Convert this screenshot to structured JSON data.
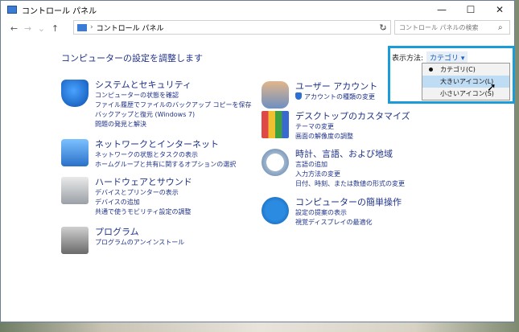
{
  "window": {
    "title": "コントロール パネル"
  },
  "address": {
    "crumb": "コントロール パネル"
  },
  "search": {
    "placeholder": "コントロール パネルの検索"
  },
  "heading": "コンピューターの設定を調整します",
  "viewby": {
    "label": "表示方法:",
    "value": "カテゴリ"
  },
  "dropdown": {
    "items": [
      "カテゴリ(C)",
      "大きいアイコン(L)",
      "小さいアイコン(S)"
    ]
  },
  "categories": {
    "system": {
      "title": "システムとセキュリティ",
      "links": [
        "コンピューターの状態を確認",
        "ファイル履歴でファイルのバックアップ コピーを保存",
        "バックアップと復元 (Windows 7)",
        "問題の発見と解決"
      ]
    },
    "network": {
      "title": "ネットワークとインターネット",
      "links": [
        "ネットワークの状態とタスクの表示",
        "ホームグループと共有に関するオプションの選択"
      ]
    },
    "hardware": {
      "title": "ハードウェアとサウンド",
      "links": [
        "デバイスとプリンターの表示",
        "デバイスの追加",
        "共通で使うモビリティ設定の調整"
      ]
    },
    "programs": {
      "title": "プログラム",
      "links": [
        "プログラムのアンインストール"
      ]
    },
    "users": {
      "title": "ユーザー アカウント",
      "links": [
        "アカウントの種類の変更"
      ]
    },
    "appearance": {
      "title": "デスクトップのカスタマイズ",
      "links": [
        "テーマの変更",
        "画面の解像度の調整"
      ]
    },
    "clock": {
      "title": "時計、言語、および地域",
      "links": [
        "言語の追加",
        "入力方法の変更",
        "日付、時刻、または数値の形式の変更"
      ]
    },
    "ease": {
      "title": "コンピューターの簡単操作",
      "links": [
        "設定の提案の表示",
        "視覚ディスプレイの最適化"
      ]
    }
  }
}
